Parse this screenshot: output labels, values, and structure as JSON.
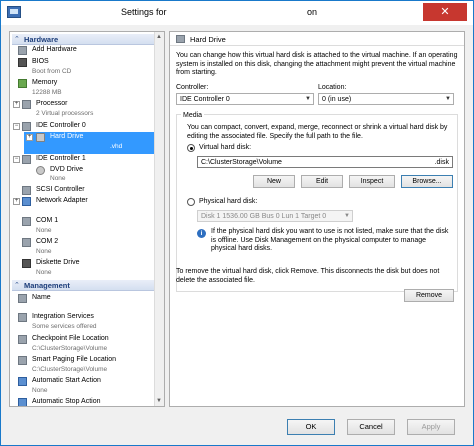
{
  "window": {
    "title": "Settings for",
    "title_suffix": "on",
    "close_glyph": "✕"
  },
  "tree": {
    "hardware_header": "Hardware",
    "management_header": "Management",
    "hardware_items": [
      {
        "label": "Add Hardware",
        "sub": "",
        "icon": "add-hardware-icon"
      },
      {
        "label": "BIOS",
        "sub": "Boot from CD",
        "icon": "bios-icon"
      },
      {
        "label": "Memory",
        "sub": "12288 MB",
        "icon": "memory-icon"
      },
      {
        "label": "Processor",
        "sub": "2 Virtual processors",
        "icon": "processor-icon"
      },
      {
        "label": "IDE Controller 0",
        "sub": "",
        "icon": "ide-controller-icon"
      },
      {
        "label": "Hard Drive",
        "sub": ".vhd",
        "icon": "hard-drive-icon"
      },
      {
        "label": "IDE Controller 1",
        "sub": "",
        "icon": "ide-controller-icon"
      },
      {
        "label": "DVD Drive",
        "sub": "None",
        "icon": "dvd-drive-icon"
      },
      {
        "label": "SCSI Controller",
        "sub": "",
        "icon": "scsi-controller-icon"
      },
      {
        "label": "Network Adapter",
        "sub": "",
        "icon": "network-adapter-icon"
      },
      {
        "label": "COM 1",
        "sub": "None",
        "icon": "com-port-icon"
      },
      {
        "label": "COM 2",
        "sub": "None",
        "icon": "com-port-icon"
      },
      {
        "label": "Diskette Drive",
        "sub": "None",
        "icon": "diskette-drive-icon"
      }
    ],
    "management_items": [
      {
        "label": "Name",
        "sub": "",
        "icon": "name-icon"
      },
      {
        "label": "Integration Services",
        "sub": "Some services offered",
        "icon": "integration-services-icon"
      },
      {
        "label": "Checkpoint File Location",
        "sub": "C:\\ClusterStorage\\Volume",
        "icon": "checkpoint-icon"
      },
      {
        "label": "Smart Paging File Location",
        "sub": "C:\\ClusterStorage\\Volume",
        "icon": "smart-paging-icon"
      },
      {
        "label": "Automatic Start Action",
        "sub": "None",
        "icon": "start-action-icon"
      },
      {
        "label": "Automatic Stop Action",
        "sub": "",
        "icon": "stop-action-icon"
      }
    ]
  },
  "panel": {
    "title": "Hard Drive",
    "intro": "You can change how this virtual hard disk is attached to the virtual machine. If an operating system is installed on this disk, changing the attachment might prevent the virtual machine from starting.",
    "controller_label": "Controller:",
    "controller_value": "IDE Controller 0",
    "location_label": "Location:",
    "location_value": "0 (in use)",
    "media_label": "Media",
    "media_desc": "You can compact, convert, expand, merge, reconnect or shrink a virtual hard disk by editing the associated file. Specify the full path to the file.",
    "vhd_radio_label": "Virtual hard disk:",
    "vhd_path": "C:\\ClusterStorage\\Volume",
    "vhd_ext": ".disk",
    "buttons": {
      "new": "New",
      "edit": "Edit",
      "inspect": "Inspect",
      "browse": "Browse..."
    },
    "physical_radio_label": "Physical hard disk:",
    "physical_value": "Disk 1 1536.00 GB Bus 0 Lun 1 Target 0",
    "physical_note": "If the physical hard disk you want to use is not listed, make sure that the disk is offline. Use Disk Management on the physical computer to manage physical hard disks.",
    "remove_note": "To remove the virtual hard disk, click Remove. This disconnects the disk but does not delete the associated file.",
    "remove_label": "Remove"
  },
  "footer": {
    "ok": "OK",
    "cancel": "Cancel",
    "apply": "Apply"
  },
  "colors": {
    "selection": "#3399ff",
    "section_header": "#1c3d7a",
    "window_border": "#1979ca"
  }
}
